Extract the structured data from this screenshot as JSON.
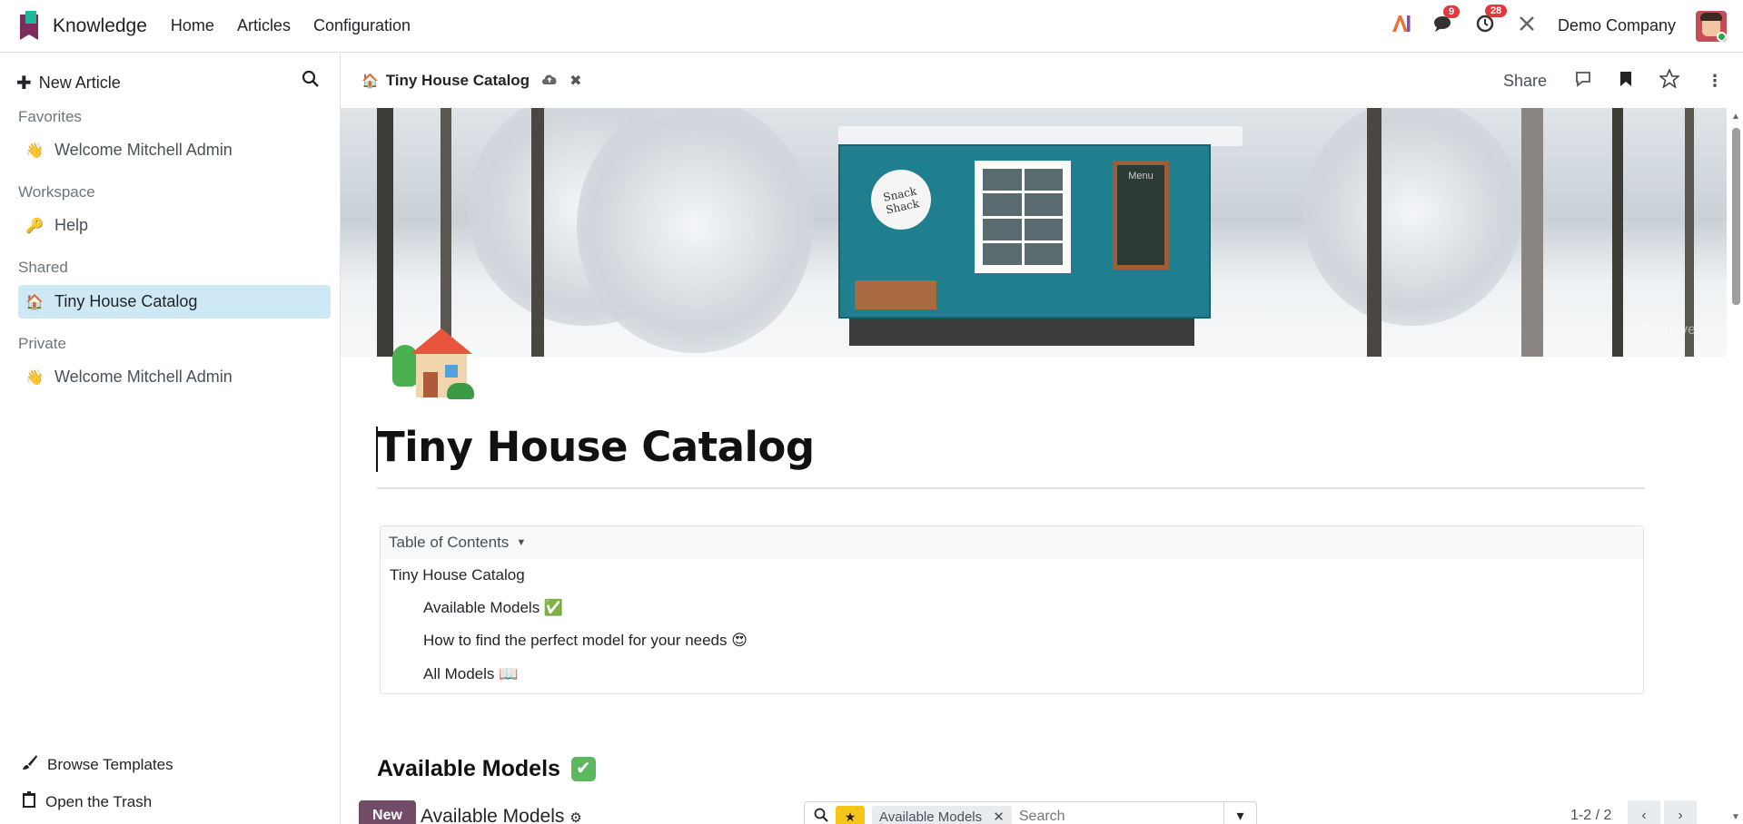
{
  "navbar": {
    "app_title": "Knowledge",
    "menu": [
      "Home",
      "Articles",
      "Configuration"
    ],
    "messages_count": "9",
    "activities_count": "28",
    "company": "Demo Company"
  },
  "sidebar": {
    "new_article": "New Article",
    "sections": {
      "favorites": "Favorites",
      "workspace": "Workspace",
      "shared": "Shared",
      "private": "Private"
    },
    "favorites_items": [
      {
        "emoji": "👋",
        "label": "Welcome Mitchell Admin"
      }
    ],
    "workspace_items": [
      {
        "emoji": "🔑",
        "label": "Help"
      }
    ],
    "shared_items": [
      {
        "emoji": "🏠",
        "label": "Tiny House Catalog"
      }
    ],
    "private_items": [
      {
        "emoji": "👋",
        "label": "Welcome Mitchell Admin"
      }
    ],
    "browse_templates": "Browse Templates",
    "open_trash": "Open the Trash"
  },
  "header": {
    "breadcrumb_emoji": "🏠",
    "breadcrumb": "Tiny House Catalog",
    "share": "Share"
  },
  "cover": {
    "sign_text": "Snack Shack",
    "menu_text": "Menu",
    "remove_label": "Remove"
  },
  "article": {
    "title": "Tiny House Catalog",
    "toc_title": "Table of Contents",
    "toc_items": [
      "Tiny House Catalog",
      "Available Models ✅",
      "How to find the perfect model for your needs 😍",
      "All Models 📖"
    ],
    "section_heading": "Available Models"
  },
  "embedded_view": {
    "new_button": "New",
    "title": "Available Models",
    "facet": "Available Models",
    "search_placeholder": "Search",
    "pager": "1-2 / 2"
  },
  "colors": {
    "brand": "#714b67",
    "active_item_bg": "#cfe8f5",
    "badge": "#e0393e"
  }
}
